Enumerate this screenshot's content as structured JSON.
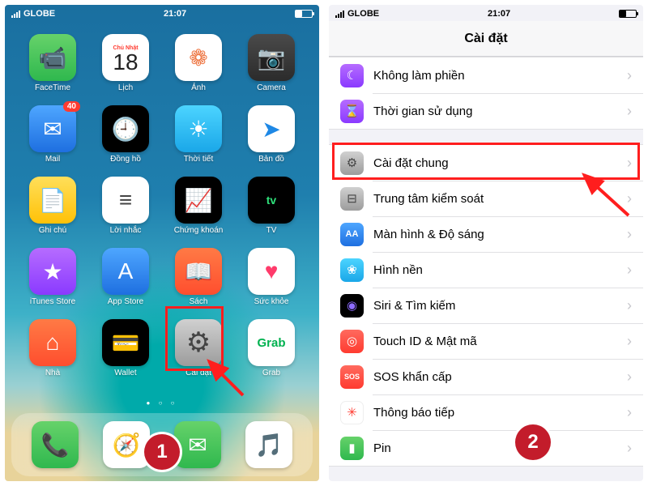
{
  "status": {
    "carrier": "GLOBE",
    "time": "21:07"
  },
  "calendar": {
    "day_name": "Chủ Nhật",
    "day_num": "18"
  },
  "badge_mail": "40",
  "apps": {
    "row1": [
      {
        "name": "facetime",
        "label": "FaceTime",
        "bg": "bg-green",
        "glyph": "📹"
      },
      {
        "name": "calendar",
        "label": "Lịch"
      },
      {
        "name": "photos",
        "label": "Ảnh",
        "bg": "bg-white",
        "glyph": "❁"
      },
      {
        "name": "camera",
        "label": "Camera",
        "bg": "bg-dkgrey",
        "glyph": "📷"
      }
    ],
    "row2": [
      {
        "name": "mail",
        "label": "Mail",
        "bg": "bg-blue",
        "glyph": "✉︎"
      },
      {
        "name": "clock",
        "label": "Đồng hồ",
        "bg": "bg-black",
        "glyph": "🕘"
      },
      {
        "name": "weather",
        "label": "Thời tiết",
        "bg": "bg-cyan",
        "glyph": "☀︎"
      },
      {
        "name": "maps",
        "label": "Bản đồ",
        "bg": "bg-white",
        "glyph": "➤"
      }
    ],
    "row3": [
      {
        "name": "notes",
        "label": "Ghi chú",
        "bg": "bg-yellow",
        "glyph": "📄"
      },
      {
        "name": "reminders",
        "label": "Lời nhắc",
        "bg": "bg-white",
        "glyph": "≡"
      },
      {
        "name": "stocks",
        "label": "Chứng khoán",
        "bg": "bg-black",
        "glyph": "📈"
      },
      {
        "name": "tv",
        "label": "TV",
        "bg": "bg-black",
        "glyph": "tv"
      }
    ],
    "row4": [
      {
        "name": "itunes",
        "label": "iTunes Store",
        "bg": "bg-purple",
        "glyph": "★"
      },
      {
        "name": "appstore",
        "label": "App Store",
        "bg": "bg-blue",
        "glyph": "A"
      },
      {
        "name": "books",
        "label": "Sách",
        "bg": "bg-orange",
        "glyph": "📖"
      },
      {
        "name": "health",
        "label": "Sức khỏe",
        "bg": "bg-white",
        "glyph": "♥"
      }
    ],
    "row5": [
      {
        "name": "home",
        "label": "Nhà",
        "bg": "bg-orange",
        "glyph": "⌂"
      },
      {
        "name": "wallet",
        "label": "Wallet",
        "bg": "bg-black",
        "glyph": "💳"
      },
      {
        "name": "settings",
        "label": "Cài đặt",
        "bg": "bg-grey",
        "glyph": "⚙︎"
      },
      {
        "name": "grab",
        "label": "Grab"
      }
    ]
  },
  "dock": [
    {
      "name": "phone",
      "bg": "bg-green",
      "glyph": "📞"
    },
    {
      "name": "safari",
      "bg": "bg-white",
      "glyph": "🧭"
    },
    {
      "name": "messages",
      "bg": "bg-green",
      "glyph": "✉"
    },
    {
      "name": "music",
      "bg": "bg-white",
      "glyph": "🎵"
    }
  ],
  "settings": {
    "title": "Cài đặt",
    "group1": [
      {
        "name": "dnd",
        "label": "Không làm phiền",
        "bg": "bg-purple",
        "glyph": "☾"
      },
      {
        "name": "screentime",
        "label": "Thời gian sử dụng",
        "bg": "bg-purple",
        "glyph": "⌛"
      }
    ],
    "group2": [
      {
        "name": "general",
        "label": "Cài đặt chung",
        "bg": "bg-grey",
        "glyph": "⚙︎"
      },
      {
        "name": "controlcenter",
        "label": "Trung tâm kiểm soát",
        "bg": "bg-grey",
        "glyph": "⊟"
      },
      {
        "name": "display",
        "label": "Màn hình & Độ sáng",
        "bg": "bg-blue",
        "glyph": "AA"
      },
      {
        "name": "wallpaper",
        "label": "Hình nền",
        "bg": "bg-cyan",
        "glyph": "❀"
      },
      {
        "name": "siri",
        "label": "Siri & Tìm kiếm",
        "bg": "bg-black",
        "glyph": "◉"
      },
      {
        "name": "touchid",
        "label": "Touch ID & Mật mã",
        "bg": "bg-red",
        "glyph": "◎"
      },
      {
        "name": "sos",
        "label": "SOS khẩn cấp",
        "bg": "bg-red",
        "glyph": "SOS"
      },
      {
        "name": "exposure",
        "label": "Thông báo tiếp",
        "bg": "bg-white",
        "glyph": "✳︎"
      },
      {
        "name": "battery",
        "label": "Pin",
        "bg": "bg-green",
        "glyph": "▮"
      }
    ]
  },
  "annotations": {
    "step1": "1",
    "step2": "2"
  }
}
